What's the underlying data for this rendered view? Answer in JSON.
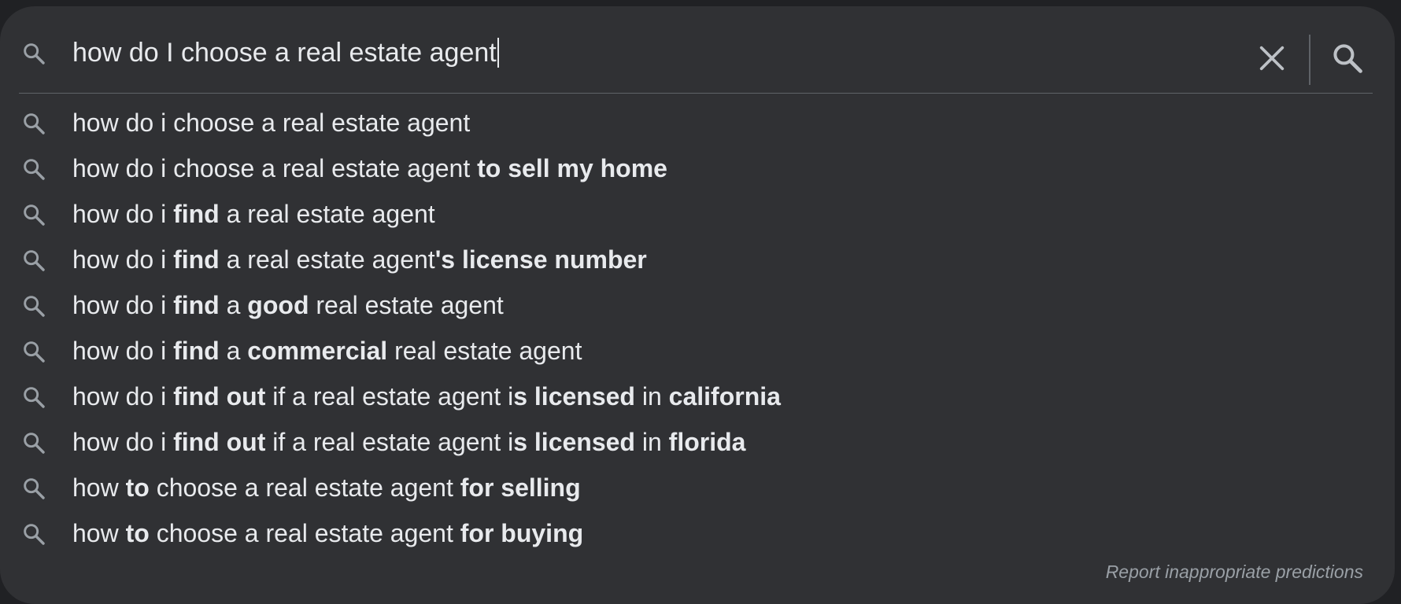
{
  "search": {
    "query": "how do I choose a real estate agent",
    "clear_icon": "close-icon",
    "search_icon": "search-icon"
  },
  "colors": {
    "panel_bg": "#303134",
    "page_bg": "#202124",
    "text": "#e8eaed",
    "muted": "#9aa0a6",
    "divider": "#5f6368"
  },
  "suggestions": [
    {
      "icon": "search-icon",
      "parts": [
        {
          "text": "how do i choose a real estate agent",
          "bold": false
        }
      ]
    },
    {
      "icon": "search-icon",
      "parts": [
        {
          "text": "how do i choose a real estate agent ",
          "bold": false
        },
        {
          "text": "to sell my home",
          "bold": true
        }
      ]
    },
    {
      "icon": "search-icon",
      "parts": [
        {
          "text": "how do i ",
          "bold": false
        },
        {
          "text": "find",
          "bold": true
        },
        {
          "text": " a real estate agent",
          "bold": false
        }
      ]
    },
    {
      "icon": "search-icon",
      "parts": [
        {
          "text": "how do i ",
          "bold": false
        },
        {
          "text": "find",
          "bold": true
        },
        {
          "text": " a real estate agent",
          "bold": false
        },
        {
          "text": "'s license number",
          "bold": true
        }
      ]
    },
    {
      "icon": "search-icon",
      "parts": [
        {
          "text": "how do i ",
          "bold": false
        },
        {
          "text": "find",
          "bold": true
        },
        {
          "text": " a ",
          "bold": false
        },
        {
          "text": "good",
          "bold": true
        },
        {
          "text": " real estate agent",
          "bold": false
        }
      ]
    },
    {
      "icon": "search-icon",
      "parts": [
        {
          "text": "how do i ",
          "bold": false
        },
        {
          "text": "find",
          "bold": true
        },
        {
          "text": " a ",
          "bold": false
        },
        {
          "text": "commercial",
          "bold": true
        },
        {
          "text": " real estate agent",
          "bold": false
        }
      ]
    },
    {
      "icon": "search-icon",
      "parts": [
        {
          "text": "how do i ",
          "bold": false
        },
        {
          "text": "find out",
          "bold": true
        },
        {
          "text": " if a real estate agent i",
          "bold": false
        },
        {
          "text": "s licensed",
          "bold": true
        },
        {
          "text": " in ",
          "bold": false
        },
        {
          "text": "california",
          "bold": true
        }
      ]
    },
    {
      "icon": "search-icon",
      "parts": [
        {
          "text": "how do i ",
          "bold": false
        },
        {
          "text": "find out",
          "bold": true
        },
        {
          "text": " if a real estate agent i",
          "bold": false
        },
        {
          "text": "s licensed",
          "bold": true
        },
        {
          "text": " in ",
          "bold": false
        },
        {
          "text": "florida",
          "bold": true
        }
      ]
    },
    {
      "icon": "search-icon",
      "parts": [
        {
          "text": "how ",
          "bold": false
        },
        {
          "text": "to",
          "bold": true
        },
        {
          "text": " choose a real estate agent ",
          "bold": false
        },
        {
          "text": "for selling",
          "bold": true
        }
      ]
    },
    {
      "icon": "search-icon",
      "parts": [
        {
          "text": "how ",
          "bold": false
        },
        {
          "text": "to",
          "bold": true
        },
        {
          "text": " choose a real estate agent ",
          "bold": false
        },
        {
          "text": "for buying",
          "bold": true
        }
      ]
    }
  ],
  "footer": {
    "report_label": "Report inappropriate predictions"
  }
}
